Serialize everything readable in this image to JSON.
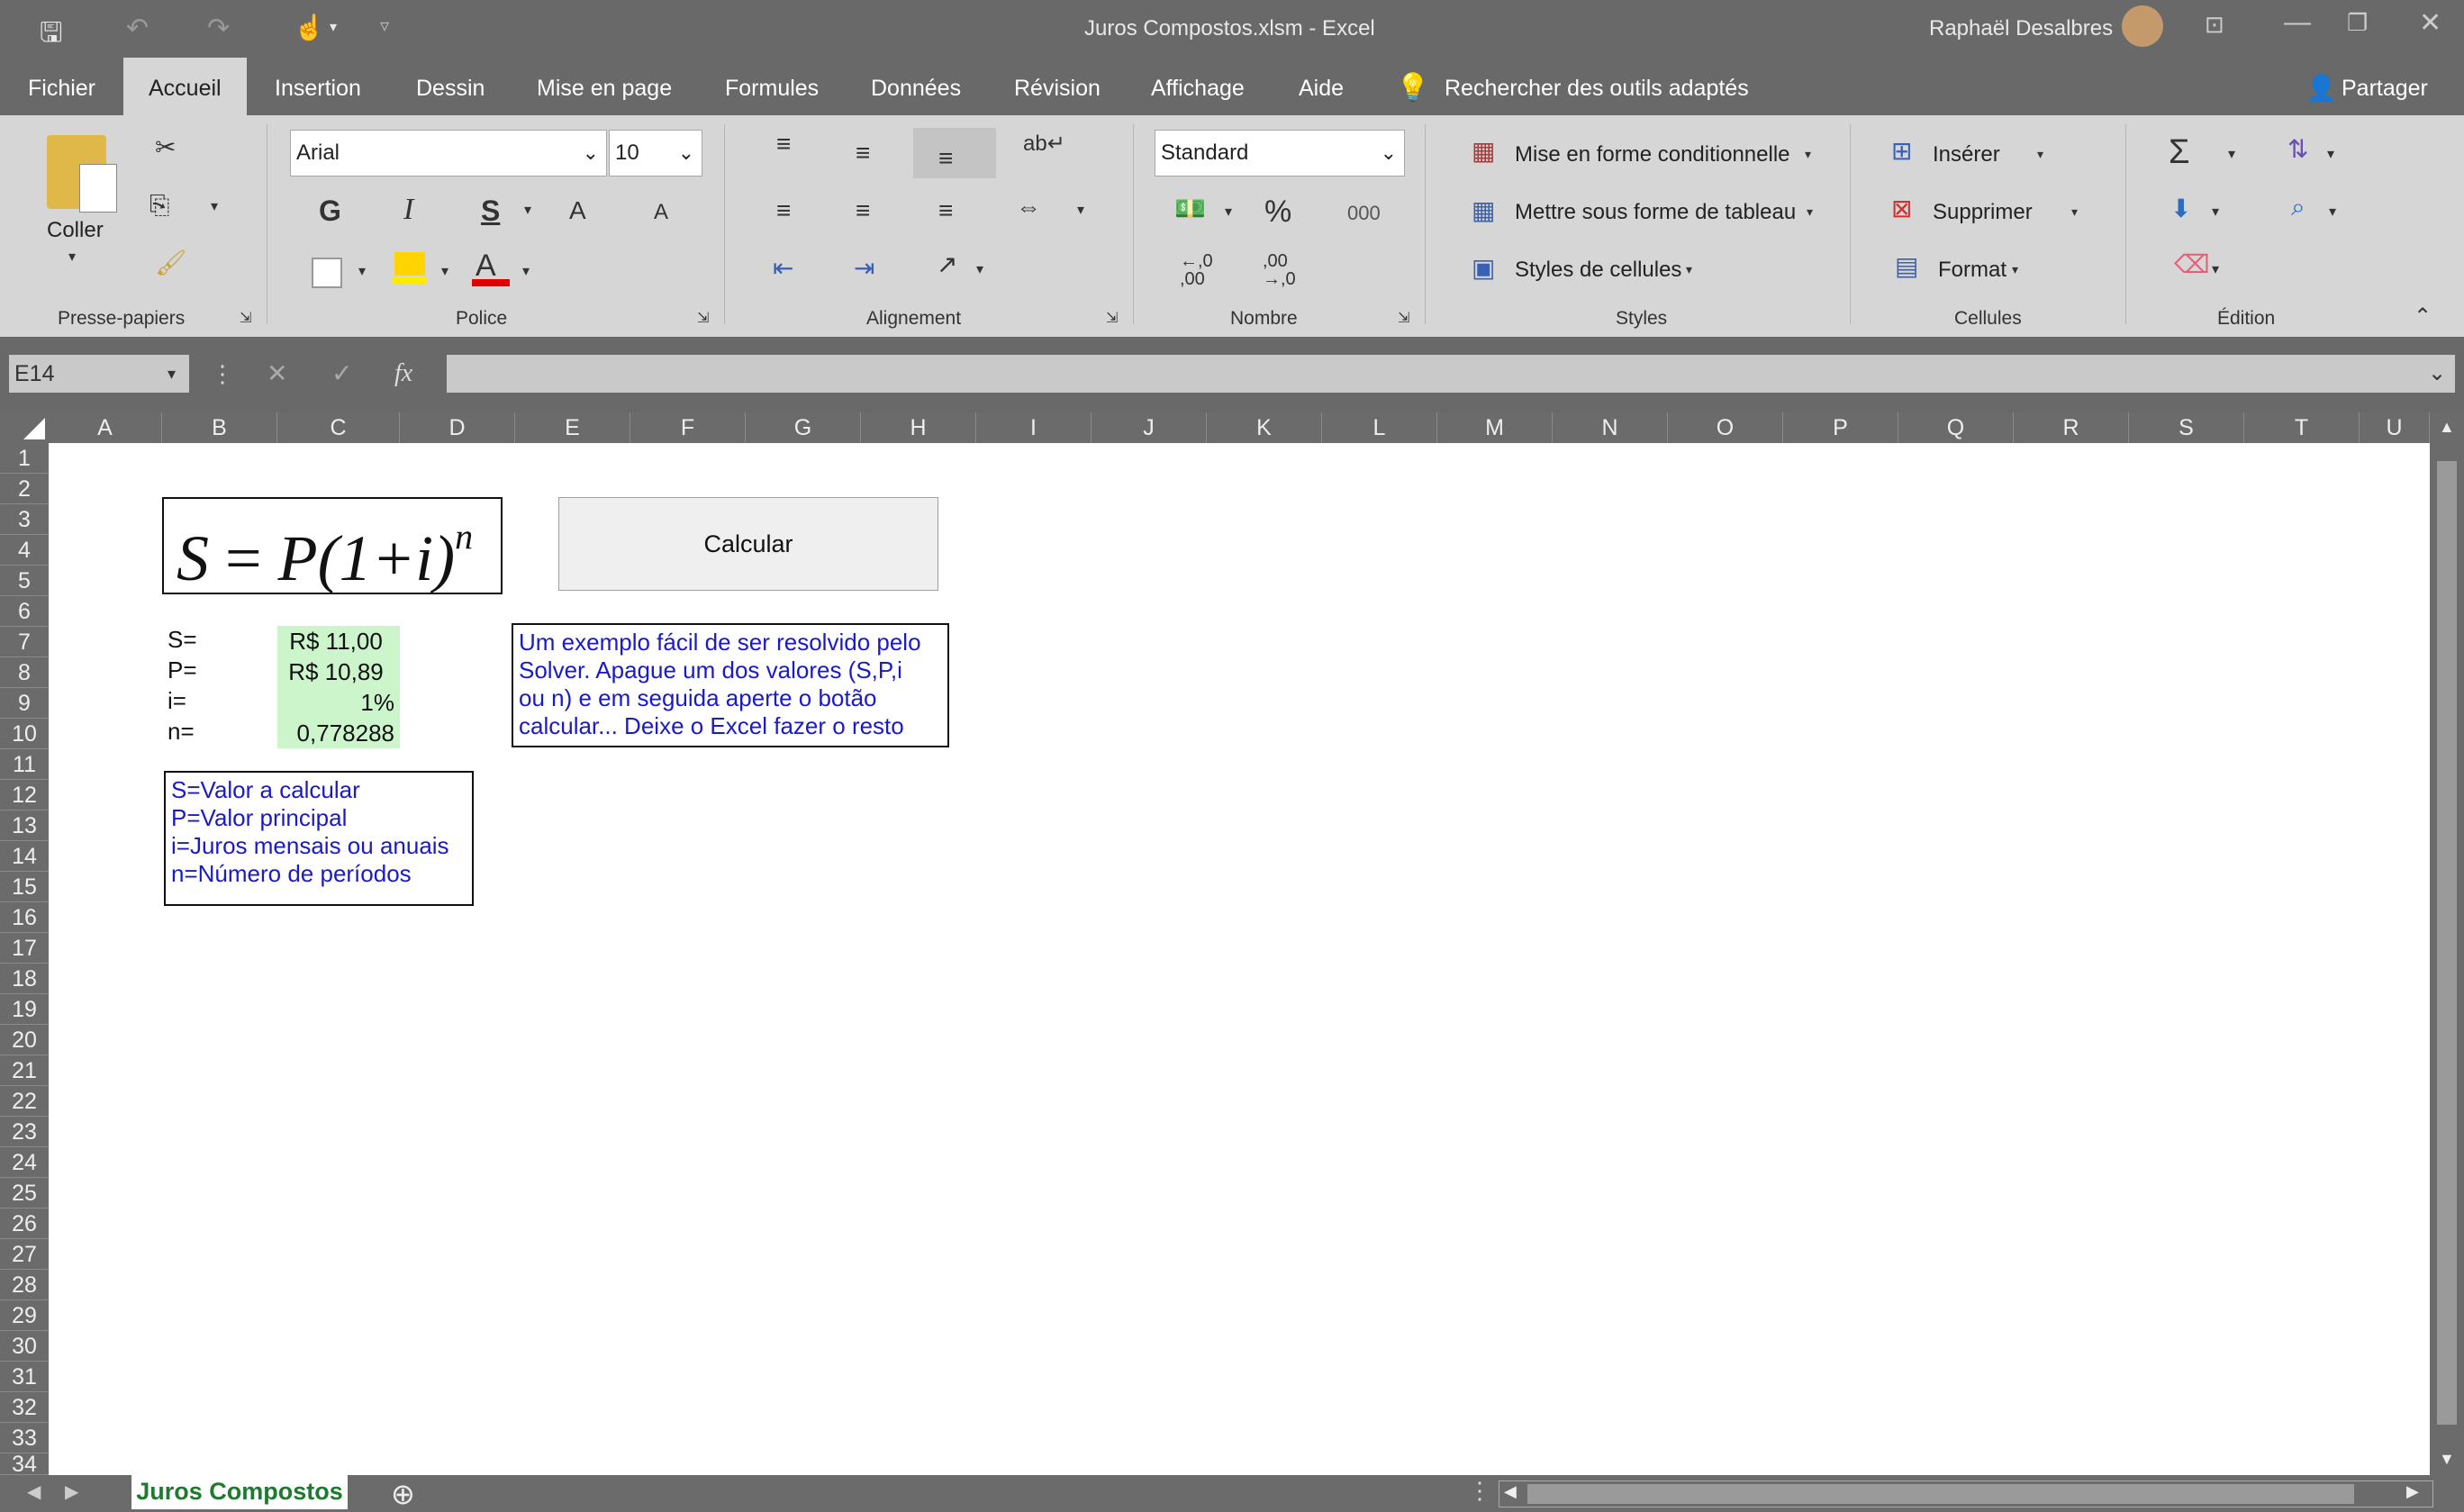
{
  "window": {
    "title": "Juros Compostos.xlsm  -  Excel",
    "user": "Raphaël Desalbres"
  },
  "tabs": [
    {
      "label": "Fichier"
    },
    {
      "label": "Accueil"
    },
    {
      "label": "Insertion"
    },
    {
      "label": "Dessin"
    },
    {
      "label": "Mise en page"
    },
    {
      "label": "Formules"
    },
    {
      "label": "Données"
    },
    {
      "label": "Révision"
    },
    {
      "label": "Affichage"
    },
    {
      "label": "Aide"
    }
  ],
  "search": {
    "label": "Rechercher des outils adaptés"
  },
  "share": {
    "label": "Partager"
  },
  "ribbon": {
    "clipboard": {
      "paste": "Coller",
      "group": "Presse-papiers"
    },
    "font": {
      "name": "Arial",
      "size": "10",
      "bold": "G",
      "italic": "I",
      "underline": "S",
      "grow": "A",
      "shrink": "A",
      "color": "A",
      "group": "Police"
    },
    "alignment": {
      "group": "Alignement"
    },
    "number": {
      "format": "Standard",
      "percent": "%",
      "thousands": "000",
      "inc_dec": "←,0 ,00",
      "dec_dec": ",00 →,0",
      "group": "Nombre"
    },
    "styles": {
      "conditional": "Mise en forme conditionnelle",
      "table": "Mettre sous forme de tableau",
      "cell_styles": "Styles de cellules",
      "group": "Styles"
    },
    "cells": {
      "insert": "Insérer",
      "delete": "Supprimer",
      "format": "Format",
      "group": "Cellules"
    },
    "editing": {
      "sum": "Σ",
      "group": "Édition"
    }
  },
  "formula_bar": {
    "name_box": "E14",
    "fx": "fx",
    "value": ""
  },
  "columns": [
    "A",
    "B",
    "C",
    "D",
    "E",
    "F",
    "G",
    "H",
    "I",
    "J",
    "K",
    "L",
    "M",
    "N",
    "O",
    "P",
    "Q",
    "R",
    "S",
    "T",
    "U"
  ],
  "rows": [
    "1",
    "2",
    "3",
    "4",
    "5",
    "6",
    "7",
    "8",
    "9",
    "10",
    "11",
    "12",
    "13",
    "14",
    "15",
    "16",
    "17",
    "18",
    "19",
    "20",
    "21",
    "22",
    "23",
    "24",
    "25",
    "26",
    "27",
    "28",
    "29",
    "30",
    "31",
    "32",
    "33",
    "34"
  ],
  "sheet": {
    "formula_image": {
      "lhs": "S",
      "eq": "=",
      "rhs": "P(1+i)",
      "exp": "n"
    },
    "calc_button": "Calcular",
    "vars": [
      {
        "label": "S=",
        "value": "R$ 11,00"
      },
      {
        "label": "P=",
        "value": "R$ 10,89"
      },
      {
        "label": "i=",
        "value": "1%"
      },
      {
        "label": "n=",
        "value": "0,778288"
      }
    ],
    "legend": [
      "S=Valor a calcular",
      "P=Valor principal",
      "i=Juros mensais ou anuais",
      "n=Número de períodos"
    ],
    "instructions": [
      "Um exemplo fácil de ser resolvido pelo",
      "Solver. Apague um dos valores (S,P,i",
      "ou n) e em seguida aperte o botão",
      "calcular... Deixe o Excel fazer o resto"
    ]
  },
  "sheet_tab": "Juros Compostos"
}
